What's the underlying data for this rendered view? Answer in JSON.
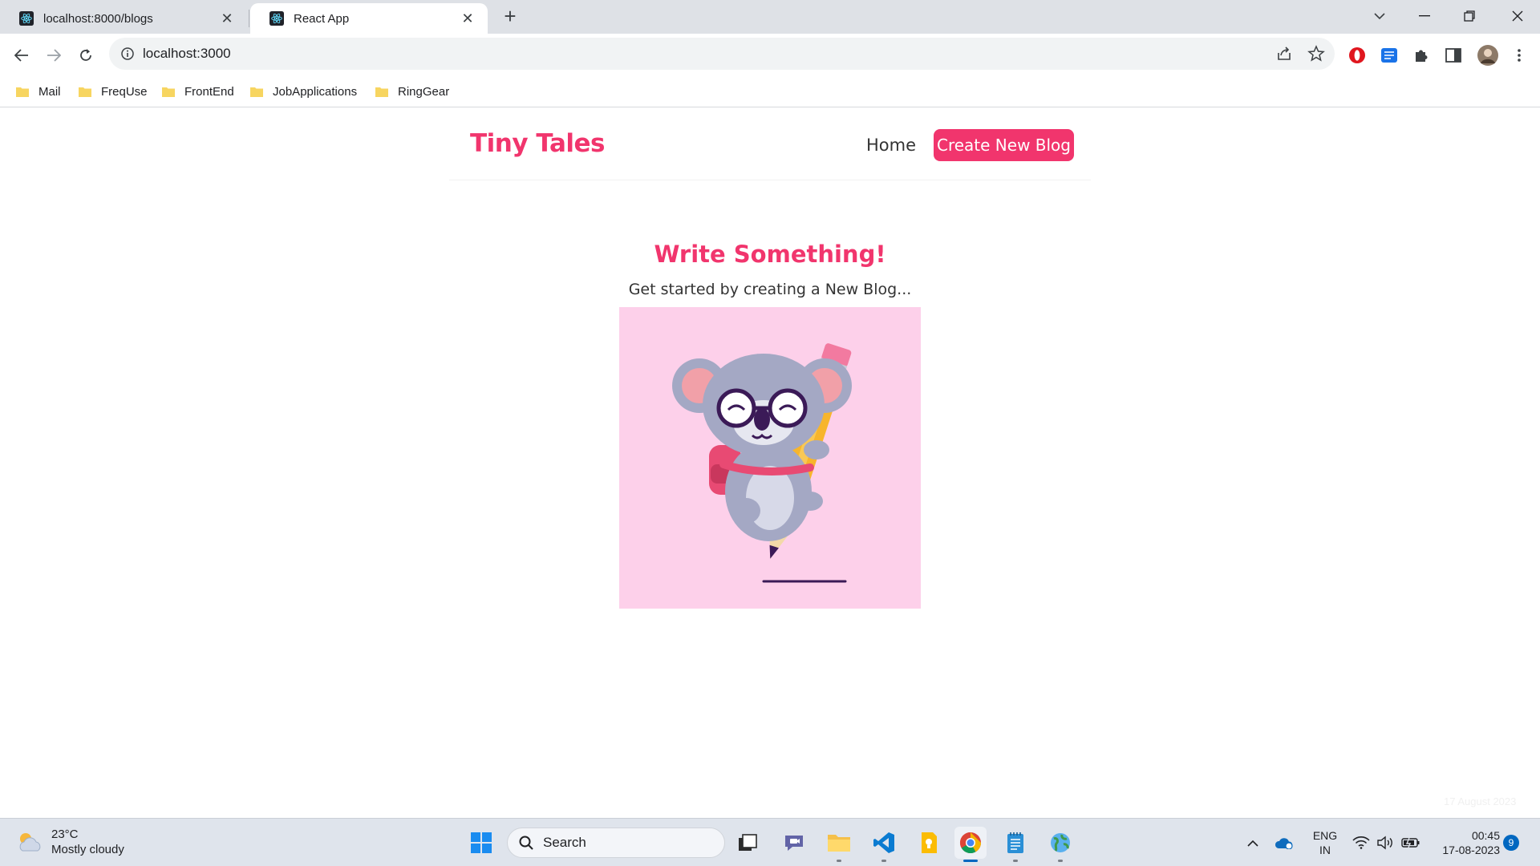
{
  "browser": {
    "tabs": [
      {
        "title": "localhost:8000/blogs",
        "active": false
      },
      {
        "title": "React App",
        "active": true
      }
    ],
    "address": "localhost:3000",
    "bookmarks": [
      "Mail",
      "FreqUse",
      "FrontEnd",
      "JobApplications",
      "RingGear"
    ]
  },
  "site": {
    "brand": "Tiny Tales",
    "nav": {
      "home": "Home",
      "create": "Create New Blog"
    },
    "hero": {
      "title": "Write Something!",
      "subtitle": "Get started by creating a New Blog...",
      "image_desc": "koala-on-pencil-illustration"
    },
    "colors": {
      "accent": "#f1356d",
      "image_bg": "#fdd0ea"
    }
  },
  "overlay": {
    "faint_date": "17 August 2023"
  },
  "taskbar": {
    "weather": {
      "temp": "23°C",
      "condition": "Mostly cloudy"
    },
    "search_label": "Search",
    "lang": {
      "line1": "ENG",
      "line2": "IN"
    },
    "clock": {
      "time": "00:45",
      "date": "17-08-2023"
    },
    "notifications": "9"
  }
}
